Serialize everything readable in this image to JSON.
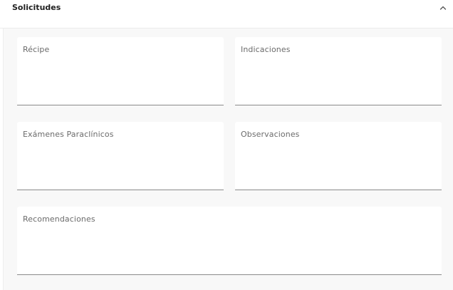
{
  "section": {
    "title": "Solicitudes",
    "toggle_icon": "chevron-up-icon",
    "expanded": true
  },
  "fields": {
    "recipe": {
      "label": "Récipe",
      "value": ""
    },
    "indicaciones": {
      "label": "Indicaciones",
      "value": ""
    },
    "examenes": {
      "label": "Exámenes Paraclínicos",
      "value": ""
    },
    "observaciones": {
      "label": "Observaciones",
      "value": ""
    },
    "recomendaciones": {
      "label": "Recomendaciones",
      "value": ""
    }
  },
  "colors": {
    "body_background": "#f8f8f8",
    "field_background": "#ffffff",
    "field_underline": "#8a8a8a",
    "label_text": "#6b6b6b",
    "title_text": "#212121"
  }
}
